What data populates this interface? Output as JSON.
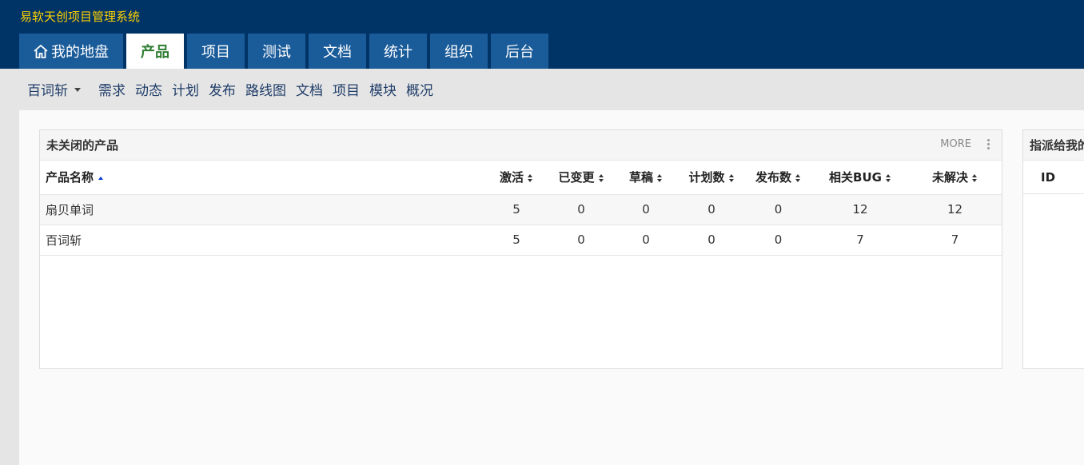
{
  "app": {
    "title": "易软天创项目管理系统"
  },
  "main_nav": [
    {
      "label": "我的地盘",
      "icon": "home-icon",
      "active": false
    },
    {
      "label": "产品",
      "active": true
    },
    {
      "label": "项目",
      "active": false
    },
    {
      "label": "测试",
      "active": false
    },
    {
      "label": "文档",
      "active": false
    },
    {
      "label": "统计",
      "active": false
    },
    {
      "label": "组织",
      "active": false
    },
    {
      "label": "后台",
      "active": false
    }
  ],
  "sub_nav": {
    "product": "百词斩",
    "items": [
      "需求",
      "动态",
      "计划",
      "发布",
      "路线图",
      "文档",
      "项目",
      "模块",
      "概况"
    ]
  },
  "products_panel": {
    "title": "未关闭的产品",
    "more_label": "MORE",
    "columns": [
      "产品名称",
      "激活",
      "已变更",
      "草稿",
      "计划数",
      "发布数",
      "相关BUG",
      "未解决"
    ],
    "rows": [
      [
        "扇贝单词",
        "5",
        "0",
        "0",
        "0",
        "0",
        "12",
        "12"
      ],
      [
        "百词斩",
        "5",
        "0",
        "0",
        "0",
        "0",
        "7",
        "7"
      ]
    ]
  },
  "assigned_panel": {
    "title": "指派给我的",
    "columns": [
      "ID"
    ]
  },
  "colors": {
    "topbar_bg": "#003366",
    "title_text": "#ffd200",
    "tab_bg": "#1a5b99",
    "active_tab_text": "#2e7d32",
    "subnav_text": "#1f3c68"
  }
}
